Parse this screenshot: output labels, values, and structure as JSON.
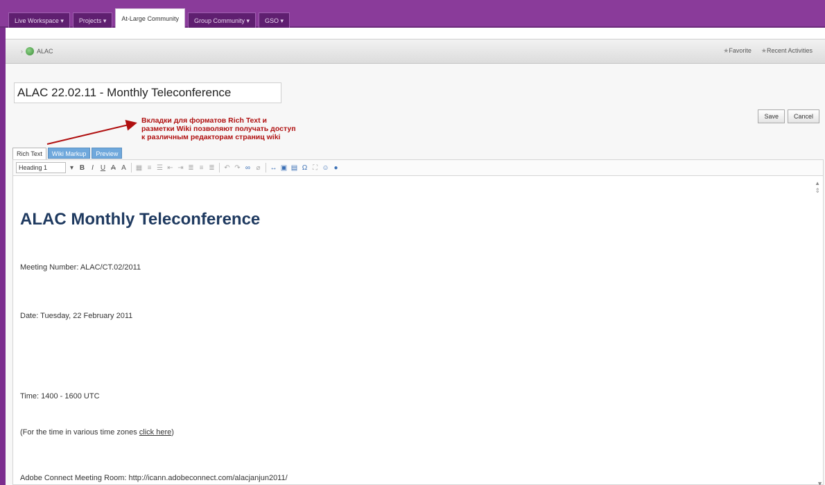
{
  "top_tabs": [
    {
      "label": "Live Workspace ▾",
      "active": false
    },
    {
      "label": "Projects ▾",
      "active": false
    },
    {
      "label": "At-Large Community",
      "active": true
    },
    {
      "label": "Group Community ▾",
      "active": false
    },
    {
      "label": "GSO ▾",
      "active": false
    }
  ],
  "breadcrumb": {
    "label": "ALAC"
  },
  "nav_actions": {
    "favorite": "Favorite",
    "recent": "Recent Activities"
  },
  "page_title": "ALAC 22.02.11 - Monthly Teleconference",
  "annotation": {
    "line1": "Вкладки для форматов Rich Text и",
    "line2": "разметки Wiki позволяют получать доступ",
    "line3": "к различным редакторам страниц wiki",
    "color": "#b01010"
  },
  "buttons": {
    "save": "Save",
    "cancel": "Cancel"
  },
  "editor_tabs": [
    {
      "label": "Rich Text",
      "active": true
    },
    {
      "label": "Wiki Markup",
      "active": false
    },
    {
      "label": "Preview",
      "active": false
    }
  ],
  "toolbar": {
    "format_value": "Heading 1"
  },
  "content": {
    "heading": "ALAC Monthly Teleconference",
    "meeting_number": "Meeting Number: ALAC/CT.02/2011",
    "date": "Date: Tuesday, 22 February 2011",
    "time": "Time: 1400 - 1600 UTC",
    "time_note_prefix": "(For the time in various time zones ",
    "time_note_link": "click here",
    "time_note_suffix": ")",
    "adobe": "Adobe Connect Meeting Room: http://icann.adobeconnect.com/alacjanjun2011/"
  },
  "colors": {
    "chrome": "#8a3b9a",
    "link_tab": "#6fa8dc",
    "heading": "#1f3a60"
  }
}
